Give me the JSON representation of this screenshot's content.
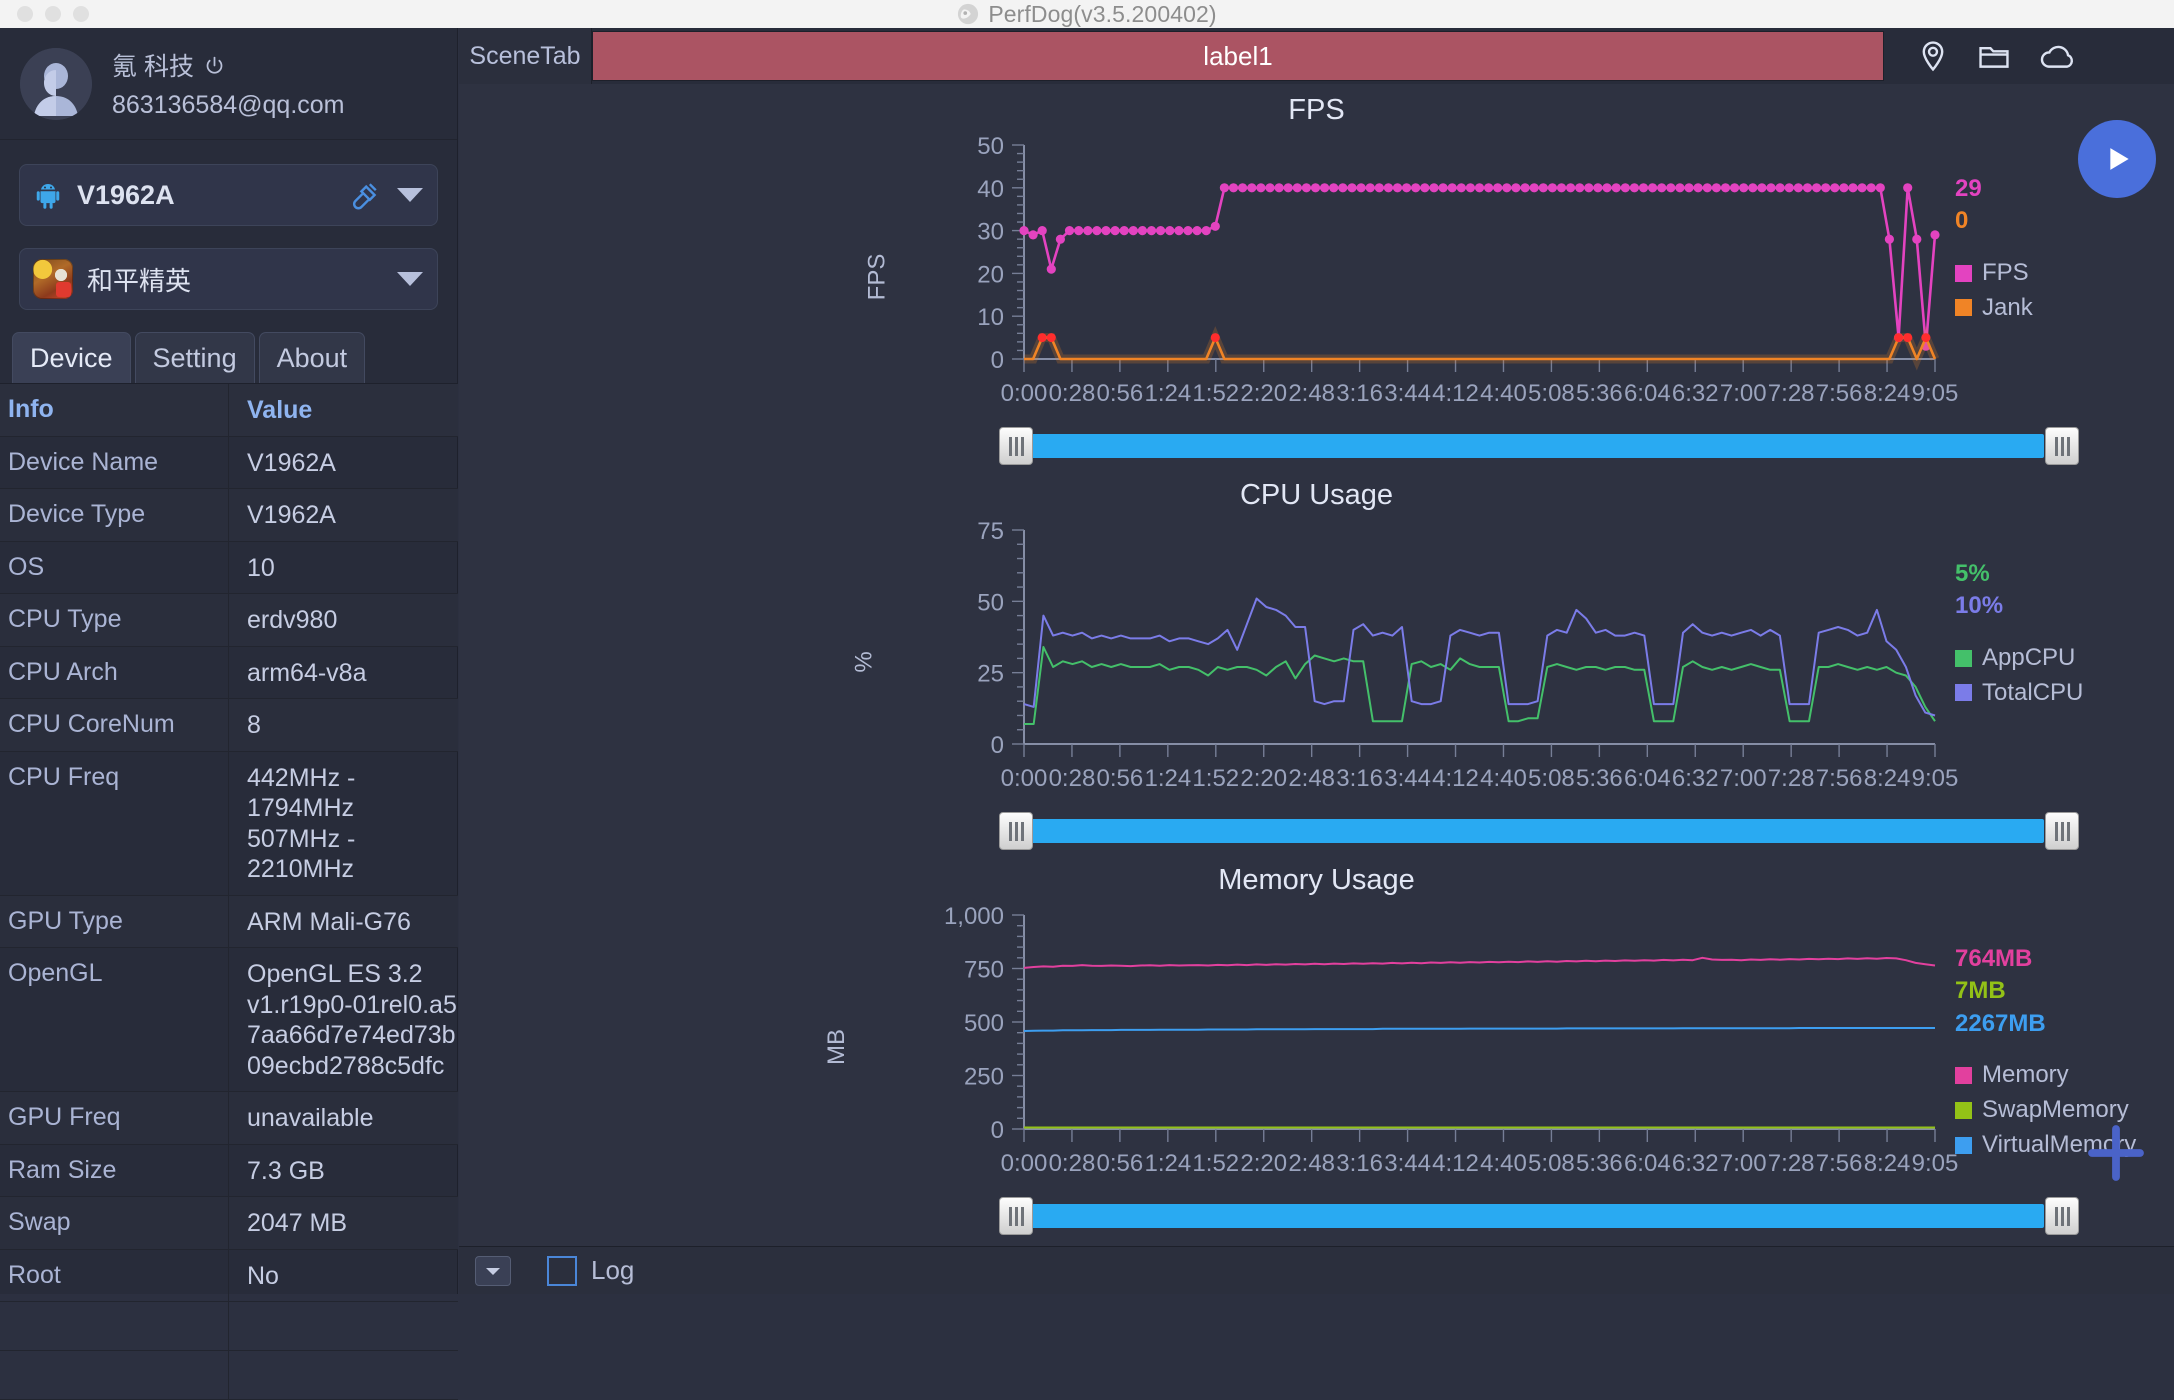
{
  "window": {
    "app_title": "PerfDog(v3.5.200402)",
    "app_icon": "perfdog-logo-icon",
    "traffic_lights": [
      "close",
      "minimize",
      "zoom"
    ]
  },
  "sidebar": {
    "account": {
      "avatar_icon": "user-avatar-icon",
      "name": "氪 科技",
      "power_icon": "power-icon",
      "email": "863136584@qq.com"
    },
    "device_selector": {
      "platform_icon": "android-icon",
      "value": "V1962A",
      "link_icon": "usb-link-icon",
      "caret_icon": "chevron-down-icon"
    },
    "app_selector": {
      "app_icon": "game-app-icon",
      "value": "和平精英",
      "caret_icon": "chevron-down-icon"
    },
    "tabs": [
      {
        "label": "Device",
        "active": true
      },
      {
        "label": "Setting",
        "active": false
      },
      {
        "label": "About",
        "active": false
      }
    ],
    "table": {
      "headers": [
        "Info",
        "Value"
      ],
      "rows": [
        {
          "key": "Device Name",
          "value": "V1962A"
        },
        {
          "key": "Device Type",
          "value": "V1962A"
        },
        {
          "key": "OS",
          "value": "10"
        },
        {
          "key": "CPU Type",
          "value": "erdv980"
        },
        {
          "key": "CPU Arch",
          "value": "arm64-v8a"
        },
        {
          "key": "CPU CoreNum",
          "value": "8"
        },
        {
          "key": "CPU Freq",
          "value": "442MHz - 1794MHz\n507MHz - 2210MHz"
        },
        {
          "key": "GPU Type",
          "value": "ARM Mali-G76"
        },
        {
          "key": "OpenGL",
          "value": "OpenGL ES 3.2\nv1.r19p0-01rel0.a5\n7aa66d7e74ed73b\n09ecbd2788c5dfc"
        },
        {
          "key": "GPU Freq",
          "value": "unavailable"
        },
        {
          "key": "Ram Size",
          "value": "7.3 GB"
        },
        {
          "key": "Swap",
          "value": "2047 MB"
        },
        {
          "key": "Root",
          "value": "No"
        }
      ]
    }
  },
  "topbar": {
    "scene_tab_label": "SceneTab",
    "label_bar_text": "label1",
    "label_bar_color": "#ab5463",
    "icons": [
      "location-pin-icon",
      "folder-icon",
      "cloud-icon"
    ]
  },
  "controls": {
    "play_button_icon": "play-icon",
    "play_button_color": "#4a6fdb",
    "add_button_icon": "plus-icon",
    "add_button_color": "#4a63c8"
  },
  "bottombar": {
    "collapse_icon": "chevron-down-icon",
    "log_checkbox_checked": false,
    "log_label": "Log"
  },
  "time_axis": {
    "ticks": [
      "0:00",
      "0:28",
      "0:56",
      "1:24",
      "1:52",
      "2:20",
      "2:48",
      "3:16",
      "3:44",
      "4:12",
      "4:40",
      "5:08",
      "5:36",
      "6:04",
      "6:32",
      "7:00",
      "7:28",
      "7:56",
      "8:24",
      "9:05"
    ]
  },
  "chart_data": [
    {
      "type": "line",
      "title": "FPS",
      "ylabel": "FPS",
      "xlabel": "",
      "ylim": [
        0,
        50
      ],
      "yticks": [
        0,
        10,
        20,
        30,
        40,
        50
      ],
      "grid": false,
      "legend_position": "right",
      "x": [
        "0:00",
        "0:28",
        "0:56",
        "1:24",
        "1:52",
        "2:20",
        "2:48",
        "3:16",
        "3:44",
        "4:12",
        "4:40",
        "5:08",
        "5:36",
        "6:04",
        "6:32",
        "7:00",
        "7:28",
        "7:56",
        "8:24",
        "9:05"
      ],
      "current_values": [
        {
          "name": "FPS",
          "value": "29",
          "color": "#e343c0"
        },
        {
          "name": "Jank",
          "value": "0",
          "color": "#f08426"
        }
      ],
      "series": [
        {
          "name": "FPS",
          "color": "#e343c0",
          "values": [
            30,
            29,
            30,
            21,
            28,
            30,
            30,
            30,
            30,
            30,
            30,
            30,
            30,
            30,
            30,
            30,
            30,
            30,
            30,
            30,
            30,
            31,
            40,
            40,
            40,
            40,
            40,
            40,
            40,
            40,
            40,
            40,
            40,
            40,
            40,
            40,
            40,
            40,
            40,
            40,
            40,
            40,
            40,
            40,
            40,
            40,
            40,
            40,
            40,
            40,
            40,
            40,
            40,
            40,
            40,
            40,
            40,
            40,
            40,
            40,
            40,
            40,
            40,
            40,
            40,
            40,
            40,
            40,
            40,
            40,
            40,
            40,
            40,
            40,
            40,
            40,
            40,
            40,
            40,
            40,
            40,
            40,
            40,
            40,
            40,
            40,
            40,
            40,
            40,
            40,
            40,
            40,
            40,
            40,
            40,
            28,
            5,
            40,
            28,
            3,
            29
          ]
        },
        {
          "name": "Jank",
          "color": "#f08426",
          "values": [
            0,
            0,
            5,
            5,
            0,
            0,
            0,
            0,
            0,
            0,
            0,
            0,
            0,
            0,
            0,
            0,
            0,
            0,
            0,
            0,
            0,
            5,
            0,
            0,
            0,
            0,
            0,
            0,
            0,
            0,
            0,
            0,
            0,
            0,
            0,
            0,
            0,
            0,
            0,
            0,
            0,
            0,
            0,
            0,
            0,
            0,
            0,
            0,
            0,
            0,
            0,
            0,
            0,
            0,
            0,
            0,
            0,
            0,
            0,
            0,
            0,
            0,
            0,
            0,
            0,
            0,
            0,
            0,
            0,
            0,
            0,
            0,
            0,
            0,
            0,
            0,
            0,
            0,
            0,
            0,
            0,
            0,
            0,
            0,
            0,
            0,
            0,
            0,
            0,
            0,
            0,
            0,
            0,
            0,
            0,
            0,
            5,
            5,
            0,
            5,
            0
          ]
        }
      ]
    },
    {
      "type": "line",
      "title": "CPU Usage",
      "ylabel": "%",
      "xlabel": "",
      "ylim": [
        0,
        75
      ],
      "yticks": [
        0,
        25,
        50,
        75
      ],
      "grid": false,
      "legend_position": "right",
      "current_values": [
        {
          "name": "AppCPU",
          "value": "5%",
          "color": "#44c06a"
        },
        {
          "name": "TotalCPU",
          "value": "10%",
          "color": "#7b7ce8"
        }
      ],
      "series": [
        {
          "name": "AppCPU",
          "color": "#44c06a",
          "values": [
            7,
            7,
            34,
            27,
            29,
            28,
            29,
            27,
            28,
            27,
            28,
            27,
            27,
            27,
            28,
            26,
            27,
            27,
            26,
            24,
            27,
            26,
            27,
            27,
            26,
            24,
            27,
            29,
            23,
            28,
            31,
            30,
            29,
            30,
            29,
            29,
            8,
            8,
            8,
            8,
            28,
            29,
            27,
            28,
            26,
            30,
            28,
            27,
            27,
            27,
            8,
            8,
            9,
            9,
            27,
            28,
            27,
            26,
            27,
            27,
            26,
            27,
            27,
            26,
            26,
            8,
            8,
            8,
            27,
            29,
            27,
            26,
            27,
            26,
            27,
            28,
            27,
            26,
            26,
            8,
            8,
            8,
            27,
            27,
            28,
            27,
            26,
            27,
            26,
            27,
            25,
            24,
            20,
            13,
            8
          ]
        },
        {
          "name": "TotalCPU",
          "color": "#7b7ce8",
          "values": [
            14,
            13,
            45,
            38,
            39,
            38,
            39,
            37,
            38,
            37,
            38,
            37,
            37,
            37,
            38,
            36,
            37,
            37,
            36,
            35,
            37,
            40,
            33,
            42,
            51,
            48,
            47,
            45,
            41,
            41,
            15,
            14,
            15,
            15,
            40,
            42,
            38,
            39,
            38,
            41,
            15,
            14,
            14,
            15,
            38,
            40,
            39,
            38,
            39,
            39,
            14,
            14,
            14,
            15,
            38,
            40,
            39,
            47,
            44,
            39,
            40,
            38,
            38,
            39,
            38,
            14,
            14,
            14,
            39,
            42,
            39,
            38,
            39,
            38,
            39,
            40,
            38,
            40,
            38,
            14,
            14,
            14,
            39,
            40,
            41,
            40,
            38,
            39,
            47,
            36,
            33,
            27,
            17,
            11,
            10
          ]
        }
      ]
    },
    {
      "type": "line",
      "title": "Memory Usage",
      "ylabel": "MB",
      "xlabel": "",
      "ylim": [
        0,
        1000
      ],
      "yticks": [
        0,
        250,
        500,
        750,
        1000
      ],
      "grid": false,
      "legend_position": "right",
      "current_values": [
        {
          "name": "Memory",
          "value": "764MB",
          "color": "#e2409e"
        },
        {
          "name": "SwapMemory",
          "value": "7MB",
          "color": "#93c217"
        },
        {
          "name": "VirtualMemory",
          "value": "2267MB",
          "color": "#3d9ef0"
        }
      ],
      "series": [
        {
          "name": "Memory",
          "color": "#e2409e",
          "values": [
            753,
            757,
            760,
            758,
            763,
            762,
            766,
            763,
            762,
            764,
            763,
            761,
            764,
            765,
            763,
            766,
            764,
            765,
            766,
            764,
            767,
            765,
            768,
            766,
            769,
            767,
            770,
            768,
            771,
            769,
            772,
            770,
            773,
            771,
            774,
            772,
            775,
            773,
            776,
            774,
            777,
            775,
            778,
            776,
            779,
            777,
            780,
            778,
            781,
            779,
            782,
            780,
            783,
            781,
            784,
            782,
            785,
            783,
            786,
            784,
            787,
            785,
            788,
            786,
            789,
            787,
            790,
            788,
            791,
            789,
            800,
            792,
            790,
            791,
            789,
            792,
            790,
            793,
            791,
            794,
            792,
            795,
            793,
            796,
            794,
            797,
            795,
            798,
            796,
            799,
            797,
            789,
            776,
            770,
            764
          ]
        },
        {
          "name": "SwapMemory",
          "color": "#93c217",
          "values": [
            7,
            7,
            7,
            7,
            7,
            7,
            7,
            7,
            7,
            7,
            7,
            7,
            7,
            7,
            7,
            7,
            7,
            7,
            7,
            7,
            7,
            7,
            7,
            7,
            7,
            7,
            7,
            7,
            7,
            7,
            7,
            7,
            7,
            7,
            7,
            7,
            7,
            7,
            7,
            7,
            7,
            7,
            7,
            7,
            7,
            7,
            7,
            7,
            7,
            7,
            7,
            7,
            7,
            7,
            7,
            7,
            7,
            7,
            7,
            7,
            7,
            7,
            7,
            7,
            7,
            7,
            7,
            7,
            7,
            7,
            7,
            7,
            7,
            7,
            7,
            7,
            7,
            7,
            7,
            7,
            7,
            7,
            7,
            7,
            7,
            7,
            7,
            7,
            7,
            7,
            7,
            7,
            7,
            7,
            7
          ]
        },
        {
          "name": "VirtualMemory",
          "color": "#3d9ef0",
          "values": [
            458,
            459,
            460,
            460,
            461,
            461,
            461,
            462,
            462,
            462,
            463,
            463,
            463,
            463,
            464,
            464,
            464,
            464,
            464,
            465,
            465,
            465,
            465,
            465,
            466,
            466,
            466,
            466,
            466,
            466,
            467,
            467,
            467,
            467,
            467,
            467,
            467,
            468,
            468,
            468,
            468,
            468,
            468,
            468,
            468,
            468,
            469,
            469,
            469,
            469,
            469,
            469,
            469,
            469,
            469,
            469,
            470,
            470,
            470,
            470,
            470,
            470,
            470,
            470,
            470,
            470,
            470,
            470,
            471,
            471,
            471,
            471,
            471,
            471,
            471,
            471,
            471,
            471,
            471,
            471,
            472,
            472,
            472,
            472,
            472,
            472,
            472,
            472,
            472,
            472,
            472,
            472,
            472,
            472,
            472
          ]
        }
      ]
    }
  ]
}
